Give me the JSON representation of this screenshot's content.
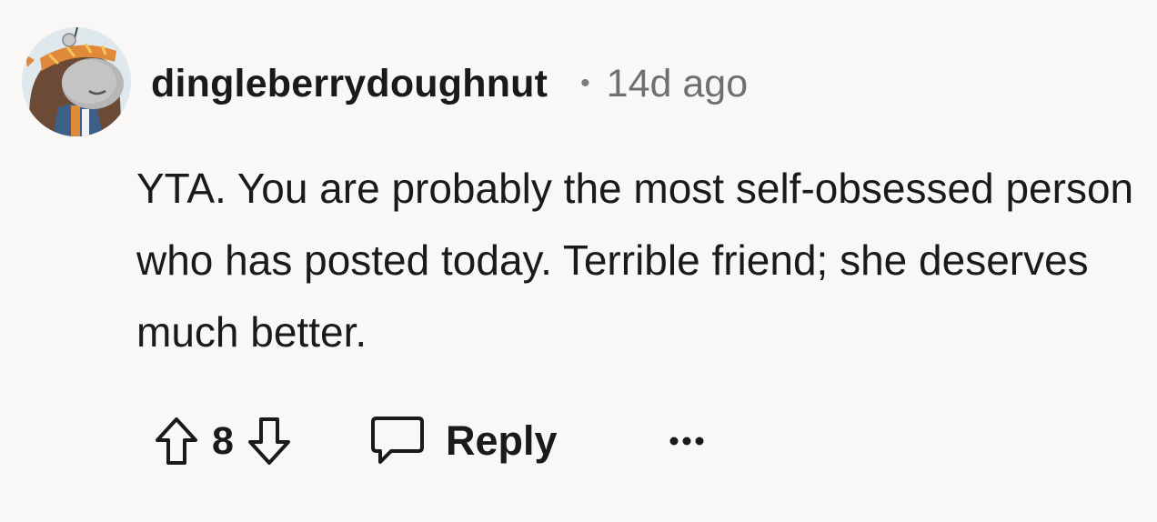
{
  "comment": {
    "username": "dingleberrydoughnut",
    "separator": "•",
    "timestamp": "14d ago",
    "body": "YTA. You are probably the most self-obsessed person who has posted today. Terrible friend; she deserves much better.",
    "score": "8",
    "reply_label": "Reply"
  },
  "icons": {
    "avatar": "snoo-avatar",
    "upvote": "arrow-up-icon",
    "downvote": "arrow-down-icon",
    "reply": "speech-bubble-icon",
    "more": "ellipsis-icon"
  },
  "colors": {
    "background": "#f9f8f6",
    "text": "#1a1a1b",
    "meta": "#6f6f6f"
  }
}
